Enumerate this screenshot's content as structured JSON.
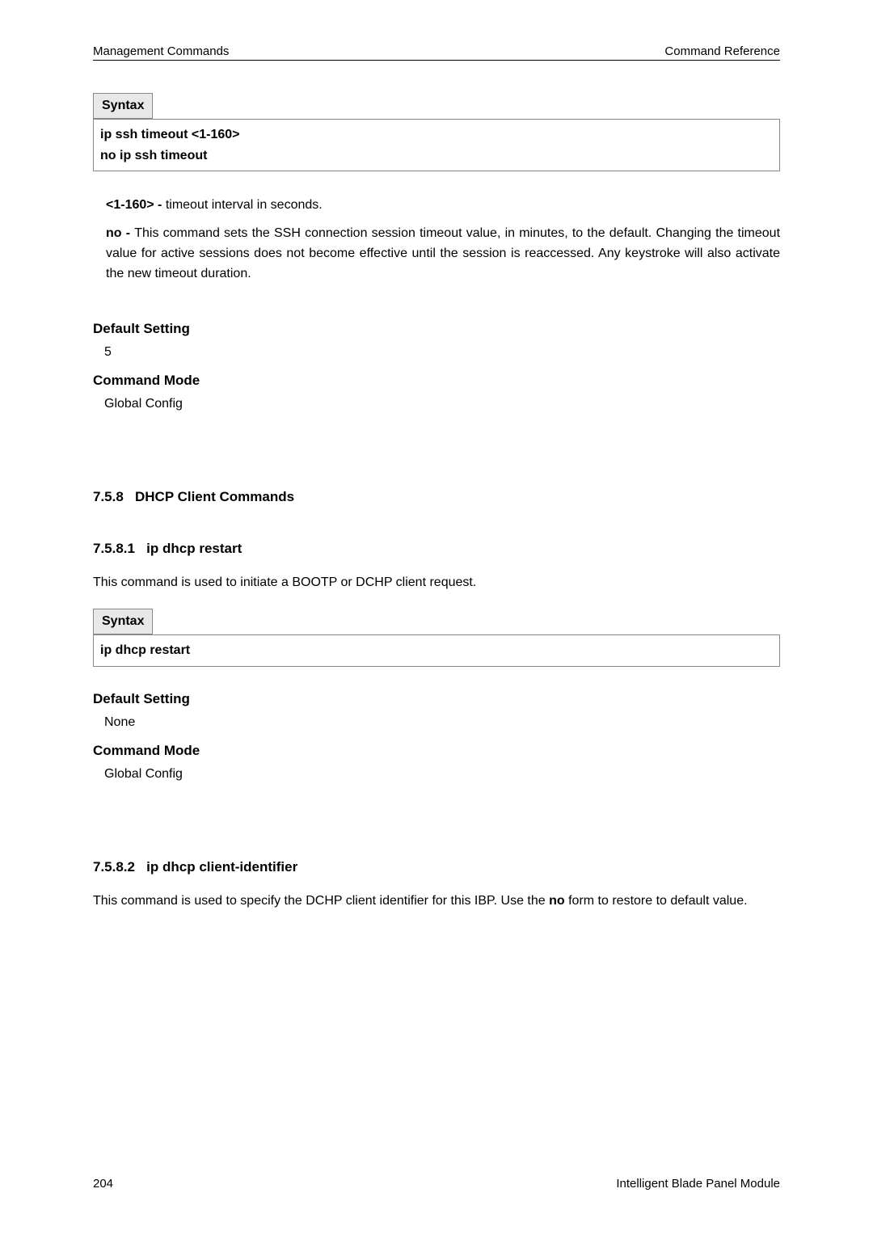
{
  "header": {
    "left": "Management Commands",
    "right": "Command Reference"
  },
  "syntax1": {
    "label": "Syntax",
    "line1": "ip ssh timeout <1-160>",
    "line2": "no ip ssh timeout"
  },
  "params1": {
    "range_bold": "<1-160> - ",
    "range_text": "timeout interval in seconds.",
    "no_bold": "no - ",
    "no_text": "This command sets the SSH connection session timeout value, in minutes, to the default. Changing the timeout value for active sessions does not become effective until the session is reaccessed. Any keystroke will also activate the new timeout duration."
  },
  "default1": {
    "heading": "Default Setting",
    "value": "5"
  },
  "mode1": {
    "heading": "Command Mode",
    "value": "Global Config"
  },
  "section758": {
    "number": "7.5.8",
    "title": "DHCP Client Commands"
  },
  "section7581": {
    "number": "7.5.8.1",
    "title": "ip dhcp restart",
    "desc": "This command is used to initiate a BOOTP or DCHP client request."
  },
  "syntax2": {
    "label": "Syntax",
    "line1": "ip dhcp restart"
  },
  "default2": {
    "heading": "Default Setting",
    "value": "None"
  },
  "mode2": {
    "heading": "Command Mode",
    "value": "Global Config"
  },
  "section7582": {
    "number": "7.5.8.2",
    "title": "ip dhcp client-identifier",
    "desc_pre": "This command is used to specify the DCHP client identifier for this IBP. Use the ",
    "desc_bold": "no",
    "desc_post": " form to restore to default value."
  },
  "footer": {
    "page": "204",
    "title": "Intelligent Blade Panel Module"
  }
}
